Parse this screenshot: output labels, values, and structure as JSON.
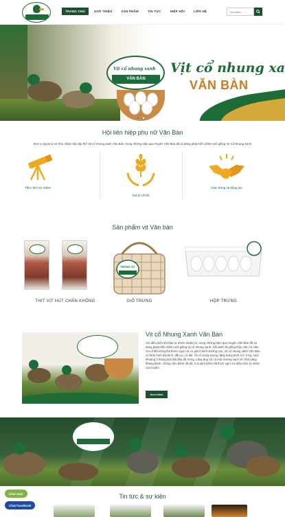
{
  "header": {
    "nav": [
      "Trang chủ",
      "Giới thiệu",
      "Sản phẩm",
      "Tin tức",
      "Hiệp hội",
      "Liên hệ"
    ],
    "search_placeholder": "Tìm kiếm..."
  },
  "hero": {
    "logo_title": "Vịt cổ nhung xanh",
    "logo_band": "VĂN BÀN",
    "title": "Vịt cổ nhung xan",
    "subtitle": "VĂN BÀN"
  },
  "association": {
    "title": "Hội liên hiệp phụ nữ Văn Bàn",
    "description": "Đơn vị Quản lý sở hữu nhãn hiệu tập thể Vịt cổ nhung xanh Văn Bàn, trong những năm qua Huyện Văn Bàn đã và đang phát triển chăn nuôi giống Vịt Cổ Nhung Xanh",
    "features": [
      {
        "label": "Tầm nhìn sứ mệnh",
        "icon": "telescope-icon"
      },
      {
        "label": "Giá trị cốt lõi",
        "icon": "wheat-hands-icon"
      },
      {
        "label": "Cảm hứng và động lực",
        "icon": "handshake-icon"
      }
    ]
  },
  "products": {
    "title": "Sản phẩm vịt Văn bàn",
    "items": [
      {
        "caption": "THỊT VỊT HÚT CHÂN KHÔNG"
      },
      {
        "caption": "GIỎ TRỨNG",
        "basket_label": "TRỨNG VỊT"
      },
      {
        "caption": "HỘP TRỨNG"
      }
    ]
  },
  "about": {
    "title": "Vịt cổ Nhung Xanh Văn Bàn",
    "text": "Với điều kiện khí hậu tự nhiên thuận lợi, trong những năm qua Huyện Văn Bàn đã và đang phát triển chăn nuôi giống vịt cổ nhung xanh. Nổi danh là giống thủy cầm có cảm cho chất lượng thịt thơm ngon và có giá trị kinh dưỡng cao. Vịt cổ nhung xanh Văn Bàn có thân hình dài bình, đầu to, cổ dài. Vịt cổ trọng lượng nặng trung bình 2,5–3 kg, nuôi khoảng 4 tháng tuổi bắt đầu đẻ trứng. Lặng ăng Vịt cổ một trường sạch sẽ, khả năng kháng bệnh, chống chịu bệnh rất tốt, ít bị dịch bệnh rất thích nghi với điều kiện tự nhiên của huyện.",
    "button": "Xem thêm"
  },
  "news": {
    "title": "Tin tức & sự kiện"
  },
  "chat": {
    "zalo": "Chat Zalo",
    "facebook": "Chat Facebook"
  },
  "colors": {
    "brand_green": "#1c4f2c",
    "accent_orange": "#cc7a1f",
    "icon_gold": "#f0a81f"
  }
}
